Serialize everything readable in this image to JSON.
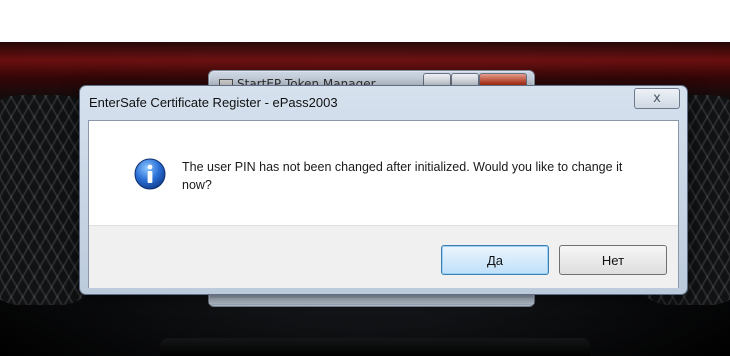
{
  "background_window": {
    "title": "StartEP Token Manager"
  },
  "dialog": {
    "title": "EnterSafe Certificate Register - ePass2003",
    "close_glyph": "x",
    "message": "The user PIN has not been changed after initialized. Would you like to change it now?",
    "icon": "info-icon",
    "buttons": {
      "yes": "Да",
      "no": "Нет"
    }
  }
}
